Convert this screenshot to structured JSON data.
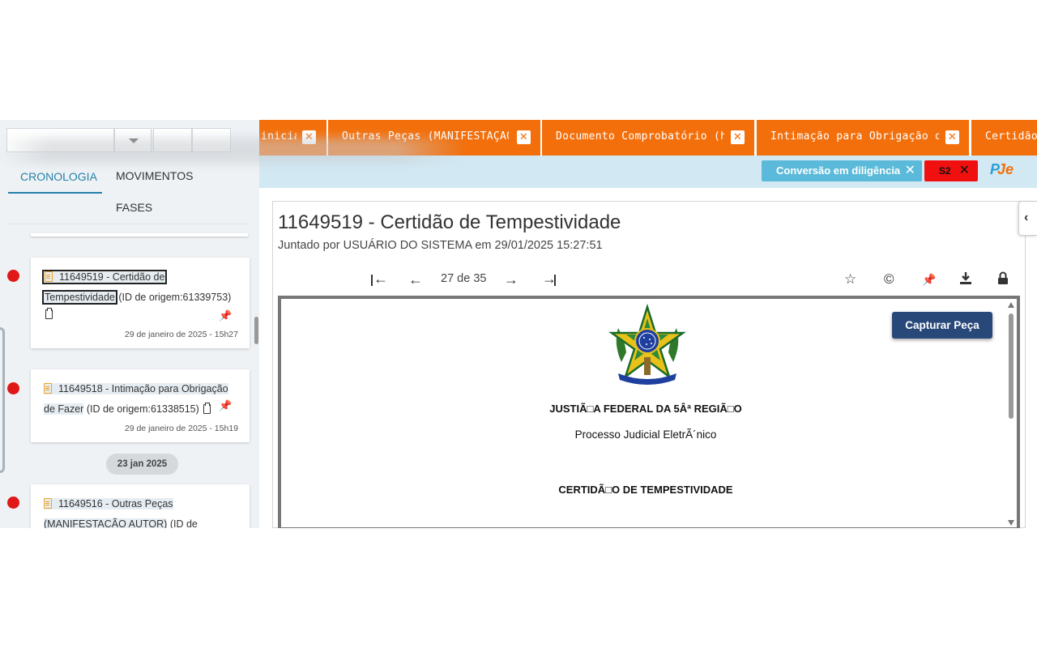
{
  "left_panel": {
    "tabs": [
      {
        "label": "CRONOLOGIA",
        "active": true
      },
      {
        "label": "MOVIMENTOS",
        "active": false
      },
      {
        "label": "FASES",
        "active": false
      }
    ],
    "items": [
      {
        "id_title": "11649519 - Certidão de",
        "id_title_2": "Tempestividade",
        "origin": "(ID de origem:61339753)",
        "date": "29 de janeiro de 2025 - 15h27"
      },
      {
        "id_title": "11649518 - Intimação para Obrigação",
        "id_title_2": "de Fazer",
        "origin": "(ID de origem:61338515)",
        "date": "29 de janeiro de 2025 - 15h19"
      },
      {
        "id_title": "11649516 - Outras Peças",
        "id_title_2": "(MANIFESTACÃO AUTOR)",
        "origin": "(ID de",
        "date": ""
      }
    ],
    "date_separator": "23 jan 2025"
  },
  "doc_tabs": [
    {
      "label": "inicial"
    },
    {
      "label": "Outras Peças (MANIFESTAÇÃO"
    },
    {
      "label": "Documento Comprobatório (hist"
    },
    {
      "label": "Intimação para Obrigação de Fa"
    },
    {
      "label": "Certidão de"
    }
  ],
  "toolbar": {
    "conversion_chip": "Conversão em diligência",
    "s2_chip": "S2",
    "close_glyph": "✕",
    "logo_p": "P",
    "logo_je": "Je"
  },
  "document": {
    "title": "11649519 - Certidão de Tempestividade",
    "subtitle": "Juntado por USUÁRIO DO SISTEMA em 29/01/2025 15:27:51",
    "page_indicator": "27 de 35",
    "capture_button": "Capturar Peça",
    "lines": {
      "court": "JUSTIÃ□A FEDERAL DA 5Âª REGIÃ□O",
      "process": "Processo Judicial EletrÃ´nico",
      "heading": "CERTIDÃ□O DE TEMPESTIVIDADE"
    }
  },
  "icons": {
    "first_page": "first-page-icon",
    "prev_page": "prev-page-icon",
    "next_page": "next-page-icon",
    "last_page": "last-page-icon",
    "star": "star-icon",
    "copyright": "copyright-icon",
    "pin": "pin-icon",
    "download": "download-icon",
    "lock": "lock-icon"
  },
  "colors": {
    "tab_orange": "#f36f0b",
    "accent_blue": "#2580a8",
    "timeline_red": "#e01818",
    "toolbar_bg": "#d2e9f4",
    "capture_btn": "#29487a",
    "chip_cyan": "#5bbad9",
    "chip_red": "#f01010"
  }
}
